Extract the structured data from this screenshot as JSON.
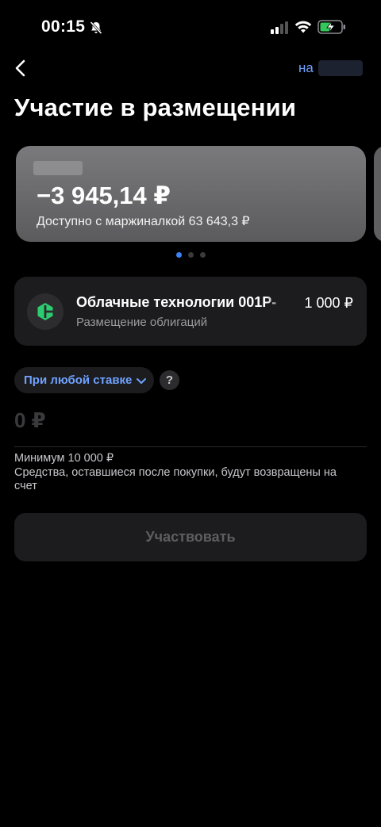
{
  "status_bar": {
    "time": "00:15"
  },
  "header": {
    "account_prefix": "на"
  },
  "title": "Участие в размещении",
  "account_card": {
    "balance": "−3 945,14 ₽",
    "available": "Доступно с маржиналкой 63 643,3 ₽"
  },
  "pager": {
    "total": 3,
    "active": 1
  },
  "bond": {
    "name": "Облачные технологии 001Р-",
    "subtitle": "Размещение облигаций",
    "price": "1 000 ₽",
    "logo_color": "#2ecc71"
  },
  "rate_selector": {
    "label": "При любой ставке"
  },
  "help": {
    "label": "?"
  },
  "amount": {
    "value": "0 ₽"
  },
  "notes": {
    "minimum": "Минимум 10 000 ₽",
    "refund": "Средства, оставшиеся после покупки, будут возвращены на счет"
  },
  "participate_button": {
    "label": "Участвовать"
  },
  "colors": {
    "accent": "#6fa2ff",
    "background": "#000000",
    "surface": "#1c1c1e"
  }
}
